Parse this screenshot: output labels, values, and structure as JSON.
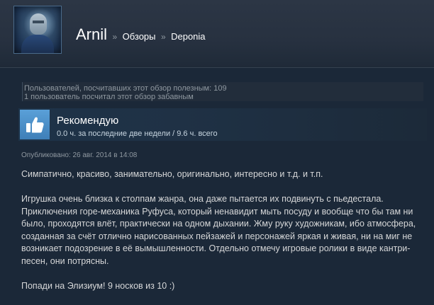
{
  "header": {
    "username": "Arnil",
    "separator": "»",
    "crumb_reviews": "Обзоры",
    "crumb_game": "Deponia"
  },
  "helpful": {
    "line1": "Пользователей, посчитавших этот обзор полезным: 109",
    "line2": "1 пользователь посчитал этот обзор забавным"
  },
  "recommendation": {
    "title": "Рекомендую",
    "hours": "0.0 ч. за последние две недели / 9.6 ч. всего",
    "icon": "thumbs-up-icon",
    "icon_bg": "#4b8fc8"
  },
  "posted": "Опубликовано: 26 авг. 2014 в 14:08",
  "review": {
    "p1": "Симпатично, красиво, занимательно, оригинально, интересно и т.д. и т.п.",
    "p2": "Игрушка очень близка к столпам жанра, она даже пытается их подвинуть с пьедестала. Приключения горе-механика Руфуса, который ненавидит мыть посуду и вообще что бы там ни было, проходятся влёт, практически на одном дыхании. Жму руку художникам, ибо атмосфера, созданная за счёт отлично нарисованных пейзажей и персонажей яркая и живая, ни на миг не возникает подозрение в её вымышленности. Отдельно отмечу игровые ролики в виде кантри-песен, они потрясны.",
    "p3": "Попади на Элизиум! 9 носков из 10 :)"
  }
}
